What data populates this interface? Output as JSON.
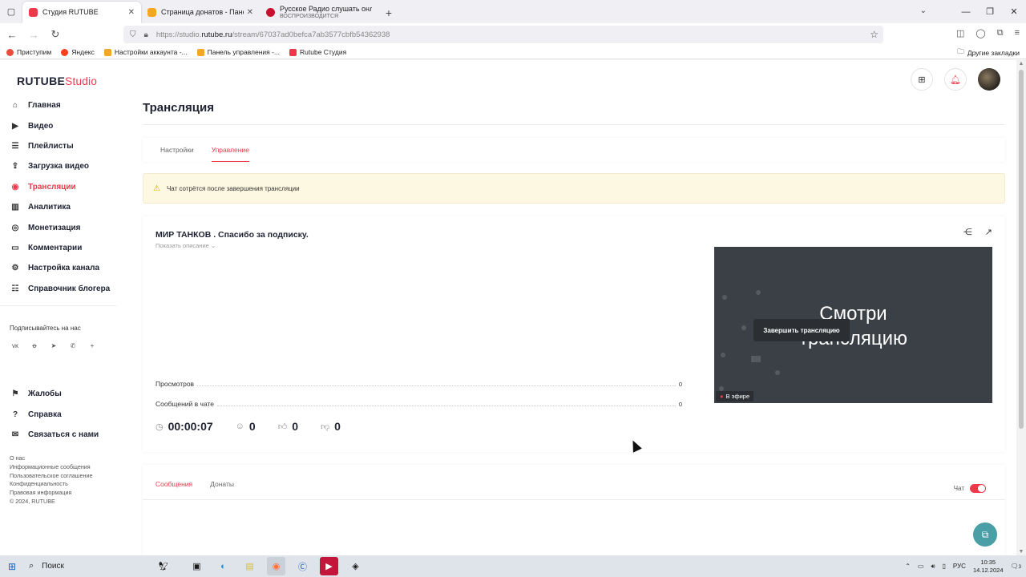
{
  "browser": {
    "tabs": [
      {
        "title": "Студия RUTUBE",
        "sub": "",
        "color": "#ed3a4a",
        "active": true
      },
      {
        "title": "Страница донатов - Панель у",
        "sub": "",
        "color": "#f5a623",
        "active": false
      },
      {
        "title": "Русское Радио слушать онлай",
        "sub": "ВОСПРОИЗВОДИТСЯ",
        "color": "#c8102e",
        "active": false
      }
    ],
    "url_prefix": "https://studio.",
    "url_domain": "rutube.ru",
    "url_path": "/stream/67037ad0befca7ab3577cbfb54362938",
    "bookmarks": [
      "Приступим",
      "Яндекс",
      "Настройки аккаунта -...",
      "Панель управления -...",
      "Rutube Студия"
    ],
    "other_bookmarks": "Другие закладки"
  },
  "logo": {
    "main": "RUTUBE",
    "accent": "Studio"
  },
  "sidebar": {
    "items": [
      {
        "label": "Главная",
        "icon": "home-icon",
        "glyph": "⌂"
      },
      {
        "label": "Видео",
        "icon": "video-icon",
        "glyph": "▶"
      },
      {
        "label": "Плейлисты",
        "icon": "playlist-icon",
        "glyph": "☰"
      },
      {
        "label": "Загрузка видео",
        "icon": "upload-icon",
        "glyph": "⇪"
      },
      {
        "label": "Трансляции",
        "icon": "broadcast-icon",
        "glyph": "◉"
      },
      {
        "label": "Аналитика",
        "icon": "analytics-icon",
        "glyph": "▥"
      },
      {
        "label": "Монетизация",
        "icon": "money-icon",
        "glyph": "◎"
      },
      {
        "label": "Комментарии",
        "icon": "comment-icon",
        "glyph": "▭"
      },
      {
        "label": "Настройка канала",
        "icon": "gear-icon",
        "glyph": "⚙"
      },
      {
        "label": "Справочник блогера",
        "icon": "book-icon",
        "glyph": "☷"
      }
    ],
    "subscribe_title": "Подписывайтесь на нас",
    "socials": [
      "vk-icon",
      "ok-icon",
      "telegram-icon",
      "viber-icon",
      "plus-icon"
    ],
    "items2": [
      {
        "label": "Жалобы",
        "icon": "flag-icon",
        "glyph": "⚑"
      },
      {
        "label": "Справка",
        "icon": "help-icon",
        "glyph": "?"
      },
      {
        "label": "Связаться с нами",
        "icon": "mail-icon",
        "glyph": "✉"
      }
    ],
    "footer": [
      "О нас",
      "Информационные сообщения",
      "Пользовательское соглашение",
      "Конфиденциальность",
      "Правовая информация",
      "© 2024, RUTUBE"
    ]
  },
  "page": {
    "title": "Трансляция",
    "tabs": [
      "Настройки",
      "Управление"
    ],
    "warning": "Чат сотрётся после завершения трансляции"
  },
  "stream": {
    "title": "МИР ТАНКОВ . Спасибо за подписку.",
    "show_description": "Показать описание",
    "stats": [
      {
        "label": "Просмотров",
        "value": "0"
      },
      {
        "label": "Сообщений в чате",
        "value": "0"
      }
    ],
    "preview_line1": "Смотри",
    "preview_line2": "трансляцию",
    "live_label": "В эфире",
    "duration": "00:00:07",
    "viewers": "0",
    "likes": "0",
    "dislikes": "0",
    "end_button": "Завершить трансляцию"
  },
  "chat": {
    "tabs": [
      "Сообщения",
      "Донаты"
    ],
    "toggle_label": "Чат",
    "enabled": true
  },
  "taskbar": {
    "search": "Поиск",
    "lang": "РУС",
    "time": "10:35",
    "date": "14.12.2024",
    "notifications": "3"
  },
  "colors": {
    "accent": "#ed3a4a",
    "dark": "#2b2f34",
    "warning_bg": "#fdf8e1"
  }
}
